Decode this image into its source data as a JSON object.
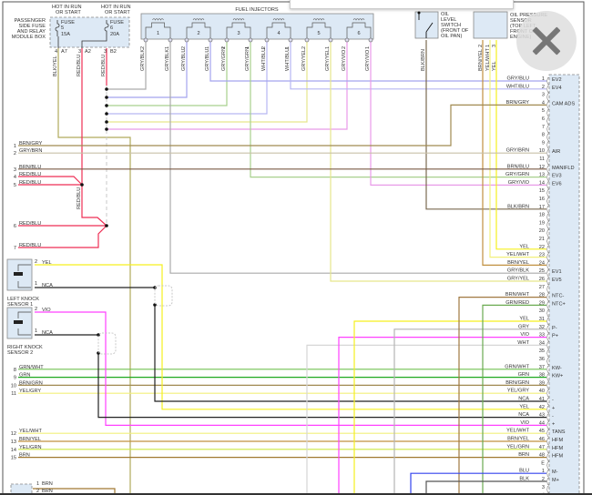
{
  "fuse_box": {
    "title": [
      "PASSENGER",
      "SIDE FUSE",
      "AND RELAY",
      "MODULE BOX"
    ],
    "fuses": [
      {
        "hot": [
          "HOT IN RUN",
          "OR START"
        ],
        "label": "FUSE",
        "number": "5",
        "rating": "15A",
        "pin_top": "4",
        "pin_bottom": "A7",
        "wire": "BLK/YEL"
      },
      {
        "hot": [
          "HOT IN RUN",
          "OR START"
        ],
        "label": "FUSE",
        "number": "6",
        "rating": "20A",
        "pin_top": "3",
        "pin_bottom": "B2",
        "wire": "RED/BLU"
      }
    ],
    "extra_pin": {
      "pin_top": "3",
      "pin_bottom": "A2",
      "wire": "RED/BLU"
    }
  },
  "fuel_injectors": {
    "title": "FUEL INJECTORS",
    "injectors": [
      {
        "n": "1",
        "pin2": "GRY/BLK",
        "pin1": "GRY/BLK"
      },
      {
        "n": "2",
        "pin2": "GRY/BLU",
        "pin1": "GRY/BLU"
      },
      {
        "n": "3",
        "pin2": "GRY/GRN",
        "pin1": "GRY/GRN"
      },
      {
        "n": "4",
        "pin2": "WHT/BLU",
        "pin1": "WHT/BLU"
      },
      {
        "n": "5",
        "pin2": "GRY/YEL",
        "pin1": "GRY/YEL"
      },
      {
        "n": "6",
        "pin2": "GRY/VIO",
        "pin1": "GRY/VIO"
      }
    ]
  },
  "oil_level_switch": {
    "label": [
      "OIL",
      "LEVEL",
      "SWITCH",
      "(FRONT OF",
      "OIL PAN)"
    ],
    "wire": "BLK/BRN"
  },
  "oil_pressure_sensor": {
    "label": [
      "OIL PRESSURE",
      "SENSOR",
      "(TOP LEFT",
      "FRONT OF",
      "ENGINE)"
    ],
    "wires": [
      {
        "pin": "2",
        "wire": "BRN/YEL"
      },
      {
        "pin": "1",
        "wire": "YEL/WHT"
      },
      {
        "pin": "3",
        "wire": "YEL"
      }
    ]
  },
  "middle_wire_label": "RED/BLU",
  "knock_sensors": [
    {
      "label": [
        "LEFT KNOCK",
        "SENSOR 1"
      ],
      "pins": [
        {
          "pin": "2",
          "wire": "YEL"
        },
        {
          "pin": "1",
          "wire": "NCA"
        }
      ]
    },
    {
      "label": [
        "RIGHT KNOCK",
        "SENSOR 2"
      ],
      "pins": [
        {
          "pin": "2",
          "wire": "VIO"
        },
        {
          "pin": "1",
          "wire": "NCA"
        }
      ]
    }
  ],
  "bottom_left_connector": [
    {
      "pin": "1",
      "wire": "BRN"
    },
    {
      "pin": "2",
      "wire": "BRN"
    }
  ],
  "left_pins": [
    {
      "pin": "1",
      "wire": "BRN/GRY"
    },
    {
      "pin": "2",
      "wire": "GRY/BRN"
    },
    {
      "pin": "3",
      "wire": "BRN/BLU"
    },
    {
      "pin": "4",
      "wire": "RED/BLU"
    },
    {
      "pin": "5",
      "wire": "RED/BLU"
    },
    {
      "pin": "6",
      "wire": "RED/BLU"
    },
    {
      "pin": "7",
      "wire": "RED/BLU"
    },
    {
      "pin": "8",
      "wire": "GRN/WHT"
    },
    {
      "pin": "9",
      "wire": "GRN"
    },
    {
      "pin": "10",
      "wire": "BRN/GRN"
    },
    {
      "pin": "11",
      "wire": "YEL/GRY"
    },
    {
      "pin": "12",
      "wire": "YEL/WHT"
    },
    {
      "pin": "13",
      "wire": "BRN/YEL"
    },
    {
      "pin": "14",
      "wire": "YEL/GRN"
    },
    {
      "pin": "15",
      "wire": "BRN"
    }
  ],
  "ecm_connector_pins": [
    {
      "pin": "1",
      "wire": "GRY/BLU",
      "func": "EV2"
    },
    {
      "pin": "2",
      "wire": "WHT/BLU",
      "func": "EV4"
    },
    {
      "pin": "3",
      "wire": "",
      "func": ""
    },
    {
      "pin": "4",
      "wire": "BRN/GRY",
      "func": "CAM ADS"
    },
    {
      "pin": "5",
      "wire": "",
      "func": ""
    },
    {
      "pin": "6",
      "wire": "",
      "func": ""
    },
    {
      "pin": "7",
      "wire": "",
      "func": ""
    },
    {
      "pin": "8",
      "wire": "",
      "func": ""
    },
    {
      "pin": "9",
      "wire": "",
      "func": ""
    },
    {
      "pin": "10",
      "wire": "GRY/BRN",
      "func": "AIR"
    },
    {
      "pin": "11",
      "wire": "",
      "func": ""
    },
    {
      "pin": "12",
      "wire": "BRN/BLU",
      "func": "MANIFLD"
    },
    {
      "pin": "13",
      "wire": "GRY/GRN",
      "func": "EV3"
    },
    {
      "pin": "14",
      "wire": "GRY/VIO",
      "func": "EV6"
    },
    {
      "pin": "15",
      "wire": "",
      "func": ""
    },
    {
      "pin": "16",
      "wire": "",
      "func": ""
    },
    {
      "pin": "17",
      "wire": "BLK/BRN",
      "func": ""
    },
    {
      "pin": "18",
      "wire": "",
      "func": ""
    },
    {
      "pin": "19",
      "wire": "",
      "func": ""
    },
    {
      "pin": "20",
      "wire": "",
      "func": ""
    },
    {
      "pin": "21",
      "wire": "",
      "func": ""
    },
    {
      "pin": "22",
      "wire": "YEL",
      "func": ""
    },
    {
      "pin": "23",
      "wire": "YEL/WHT",
      "func": ""
    },
    {
      "pin": "24",
      "wire": "BRN/YEL",
      "func": ""
    },
    {
      "pin": "25",
      "wire": "GRY/BLK",
      "func": "EV1"
    },
    {
      "pin": "26",
      "wire": "GRY/YEL",
      "func": "EV5"
    },
    {
      "pin": "27",
      "wire": "",
      "func": ""
    },
    {
      "pin": "28",
      "wire": "BRN/WHT",
      "func": "NTC-"
    },
    {
      "pin": "29",
      "wire": "GRN/RED",
      "func": "NTC+"
    },
    {
      "pin": "30",
      "wire": "",
      "func": ""
    },
    {
      "pin": "31",
      "wire": "YEL",
      "func": ""
    },
    {
      "pin": "32",
      "wire": "GRY",
      "func": "P-"
    },
    {
      "pin": "33",
      "wire": "VIO",
      "func": "P+"
    },
    {
      "pin": "34",
      "wire": "WHT",
      "func": ""
    },
    {
      "pin": "35",
      "wire": "",
      "func": ""
    },
    {
      "pin": "36",
      "wire": "",
      "func": ""
    },
    {
      "pin": "37",
      "wire": "GRN/WHT",
      "func": "KW-"
    },
    {
      "pin": "38",
      "wire": "GRN",
      "func": "KW+"
    },
    {
      "pin": "39",
      "wire": "BRN/GRN",
      "func": ""
    },
    {
      "pin": "40",
      "wire": "YEL/GRY",
      "func": ""
    },
    {
      "pin": "41",
      "wire": "NCA",
      "func": "-"
    },
    {
      "pin": "42",
      "wire": "YEL",
      "func": "+"
    },
    {
      "pin": "43",
      "wire": "NCA",
      "func": "-"
    },
    {
      "pin": "44",
      "wire": "VIO",
      "func": "+"
    },
    {
      "pin": "45",
      "wire": "YEL/WHT",
      "func": "TANS"
    },
    {
      "pin": "46",
      "wire": "BRN/YEL",
      "func": "HFM"
    },
    {
      "pin": "47",
      "wire": "YEL/GRN",
      "func": "HFM"
    },
    {
      "pin": "48",
      "wire": "BRN",
      "func": "HFM"
    },
    {
      "pin": "E",
      "wire": "",
      "func": ""
    },
    {
      "pin": "1",
      "wire": "BLU",
      "func": "M-"
    },
    {
      "pin": "2",
      "wire": "BLK",
      "func": "M+"
    },
    {
      "pin": "3",
      "wire": "",
      "func": ""
    },
    {
      "pin": "4",
      "wire": "",
      "func": ""
    }
  ],
  "wire_colors": {
    "GRY": "#b4b4b4",
    "GRY/BLK": "#aaaaaa",
    "GRY/BLU": "#a4a4ee",
    "WHT/BLU": "#b6b6f2",
    "GRY/GRN": "#a8d08d",
    "GRY/YEL": "#e6e68c",
    "GRY/VIO": "#e89ae8",
    "BRN/GRY": "#a08a50",
    "GRY/BRN": "#c8c0a8",
    "BRN/BLU": "#7a5a45",
    "RED/BLU": "#ee2f55",
    "BLK/YEL": "#b0ab5c",
    "BLK/BRN": "#7a6a50",
    "YEL": "#f5f01e",
    "YEL/WHT": "#f2f07c",
    "BRN/YEL": "#c09040",
    "BRN/WHT": "#a07840",
    "GRN/RED": "#6aaa50",
    "VIO": "#ff40ff",
    "WHT": "#d6d6d6",
    "GRN/WHT": "#70c050",
    "GRN": "#1fa81f",
    "BRN/GRN": "#a08850",
    "YEL/GRY": "#f3ef7a",
    "NCA": "#222222",
    "YEL/GRN": "#cbe840",
    "BRN": "#a07830",
    "BLU": "#3344ee",
    "BLK": "#555555"
  },
  "overlay": {
    "close_icon": "close-x-icon"
  }
}
